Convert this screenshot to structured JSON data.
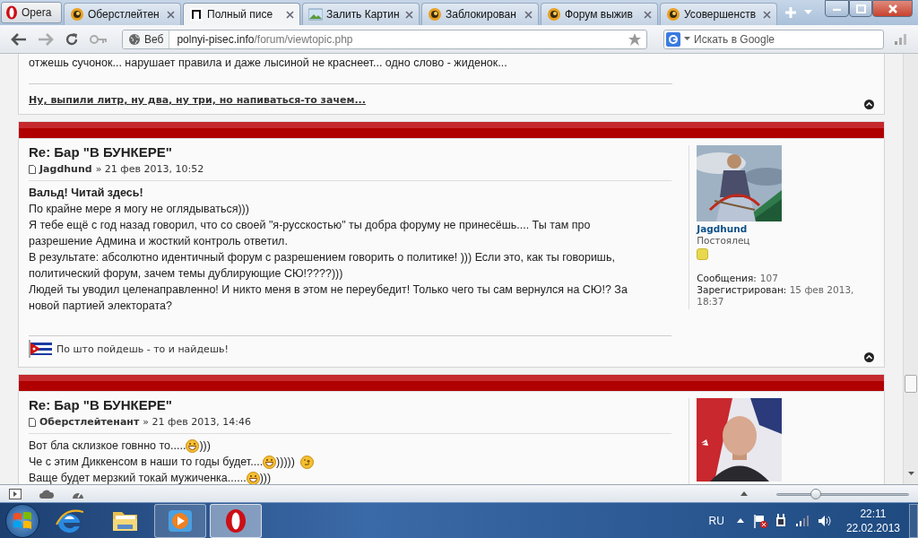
{
  "browser": {
    "menu_button": "Opera",
    "tabs": [
      {
        "title": "Оберстлейтен",
        "kind": "forum",
        "selected": false
      },
      {
        "title": "Полный писе",
        "kind": "letter",
        "selected": true
      },
      {
        "title": "Залить Картин",
        "selected": false
      },
      {
        "title": "Заблокирован",
        "kind": "forum",
        "selected": false
      },
      {
        "title": "Форум выжив",
        "kind": "forum",
        "selected": false
      },
      {
        "title": "Усовершенств",
        "kind": "forum",
        "selected": false
      }
    ],
    "address_bar": {
      "badge": "Веб",
      "host": "polnyi-pisec.info",
      "path": "/forum/viewtopic.php"
    },
    "search": {
      "placeholder": "Искать в Google"
    }
  },
  "previous_post": {
    "text": "отжешь сучонок... нарушает правила и даже лысиной не краснеет... одно слово - жиденок...",
    "signature": "Ну, выпили литр, ну два, ну три, но напиваться-то зачем..."
  },
  "posts": [
    {
      "title": "Re: Бар \"В БУНКЕРЕ\"",
      "author": "Jagdhund",
      "date": "» 21 фев 2013, 10:52",
      "lines": [
        [
          {
            "kind": "text",
            "text": "Вальд! Читай здесь!",
            "bold": true
          }
        ],
        [
          {
            "kind": "text",
            "text": "По крайне мере я могу не оглядываться)))",
            "bold": false
          }
        ],
        [
          {
            "kind": "text",
            "text": "Я тебе ещё с год назад говорил, что со своей \"я-русскостью\" ты добра форуму не принесёшь.... Ты там про",
            "bold": false
          }
        ],
        [
          {
            "kind": "text",
            "text": "разрешение Админа и жосткий контроль ответил.",
            "bold": false
          }
        ],
        [
          {
            "kind": "text",
            "text": "В результате: абсолютно идентичный форум с разрешением говорить о политике! ))) Если это, как ты говоришь,",
            "bold": false
          }
        ],
        [
          {
            "kind": "text",
            "text": "политический форум, зачем темы дублирующие СЮ!????)))",
            "bold": false
          }
        ],
        [
          {
            "kind": "text",
            "text": "Людей ты уводил целенаправленно! И никто меня в этом не переубедит! Только чего ты сам вернулся на СЮ!? За",
            "bold": false
          }
        ],
        [
          {
            "kind": "text",
            "text": "новой партией электората?",
            "bold": false
          }
        ]
      ],
      "signature": "По што пойдешь - то и найдешь!",
      "profile": {
        "name": "Jagdhund",
        "rank": "Постоялец",
        "posts_label": "Сообщения:",
        "posts": "107",
        "registered_label": "Зарегистрирован:",
        "registered": "15 фев 2013, 18:37"
      }
    },
    {
      "title": "Re: Бар \"В БУНКЕРЕ\"",
      "author": "Оберстлейтенант",
      "date": "» 21 фев 2013, 14:46",
      "lines": [
        [
          {
            "kind": "text",
            "text": "Вот бла склизкое говнно то.....",
            "bold": false
          },
          {
            "kind": "grin"
          },
          {
            "kind": "text",
            "text": ")))",
            "bold": false
          }
        ],
        [
          {
            "kind": "text",
            "text": "Че с этим Диккенсом в наши то годы будет....",
            "bold": false
          },
          {
            "kind": "grin"
          },
          {
            "kind": "text",
            "text": "))))) ",
            "bold": false
          },
          {
            "kind": "wink"
          }
        ],
        [
          {
            "kind": "text",
            "text": "Ваще будет мерзкий токай мужиченка......",
            "bold": false
          },
          {
            "kind": "grin"
          },
          {
            "kind": "text",
            "text": ")))",
            "bold": false
          }
        ]
      ]
    }
  ],
  "status_bar": {
    "zoom": {
      "level": 0.28
    }
  },
  "taskbar": {
    "apps": [
      {
        "kind": "ie",
        "running": false,
        "selected": false
      },
      {
        "kind": "folder",
        "running": false,
        "selected": false
      },
      {
        "kind": "media",
        "running": true,
        "selected": false
      },
      {
        "kind": "opera",
        "running": true,
        "selected": true
      }
    ],
    "language": "RU",
    "time": "22:11",
    "date": "22.02.2013"
  }
}
